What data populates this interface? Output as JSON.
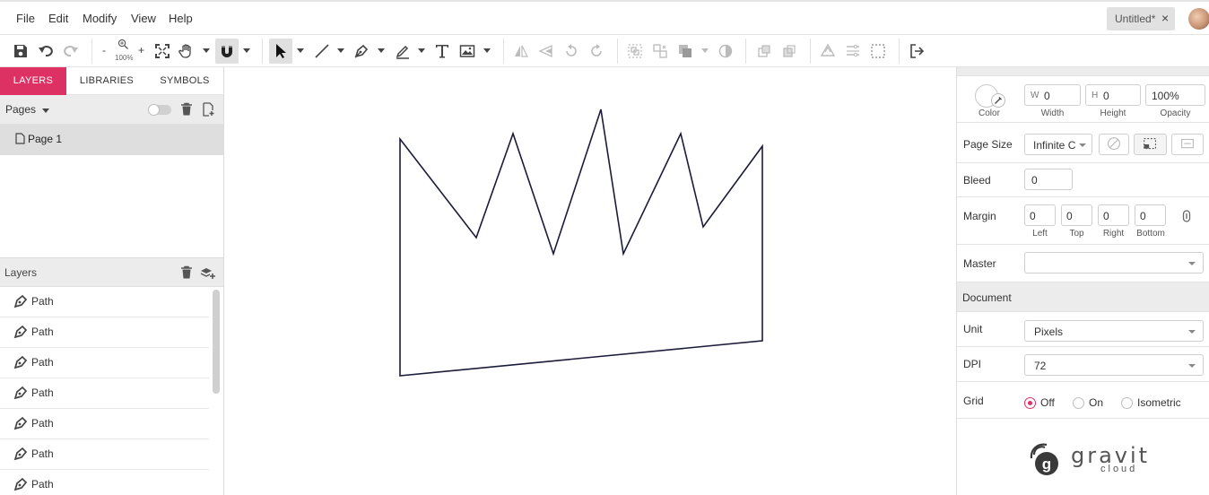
{
  "menu": [
    "File",
    "Edit",
    "Modify",
    "View",
    "Help"
  ],
  "document_tab": {
    "title": "Untitled*",
    "close": "×"
  },
  "toolbar": {
    "zoom_out": "-",
    "zoom_level": "100%",
    "zoom_in": "+"
  },
  "left_tabs": [
    "LAYERS",
    "LIBRARIES",
    "SYMBOLS"
  ],
  "pages": {
    "header": "Pages",
    "items": [
      "Page 1"
    ]
  },
  "layers": {
    "header": "Layers",
    "items": [
      "Path",
      "Path",
      "Path",
      "Path",
      "Path",
      "Path",
      "Path"
    ]
  },
  "inspector": {
    "color_label": "Color",
    "width": {
      "prefix": "W",
      "value": "0",
      "label": "Width"
    },
    "height": {
      "prefix": "H",
      "value": "0",
      "label": "Height"
    },
    "opacity": {
      "value": "100%",
      "label": "Opacity"
    },
    "page_size": {
      "label": "Page Size",
      "value": "Infinite C"
    },
    "bleed": {
      "label": "Bleed",
      "value": "0"
    },
    "margin": {
      "label": "Margin",
      "values": [
        "0",
        "0",
        "0",
        "0"
      ],
      "sublabels": [
        "Left",
        "Top",
        "Right",
        "Bottom"
      ]
    },
    "master": {
      "label": "Master",
      "value": ""
    },
    "document_header": "Document",
    "unit": {
      "label": "Unit",
      "value": "Pixels"
    },
    "dpi": {
      "label": "DPI",
      "value": "72"
    },
    "grid": {
      "label": "Grid",
      "options": [
        "Off",
        "On",
        "Isometric"
      ],
      "selected": "Off"
    }
  },
  "brand": {
    "name": "gravit",
    "sub": "cloud"
  },
  "colors": {
    "accent": "#de3163",
    "panel_header": "#ececec",
    "shape_stroke": "#1b1b3a"
  }
}
